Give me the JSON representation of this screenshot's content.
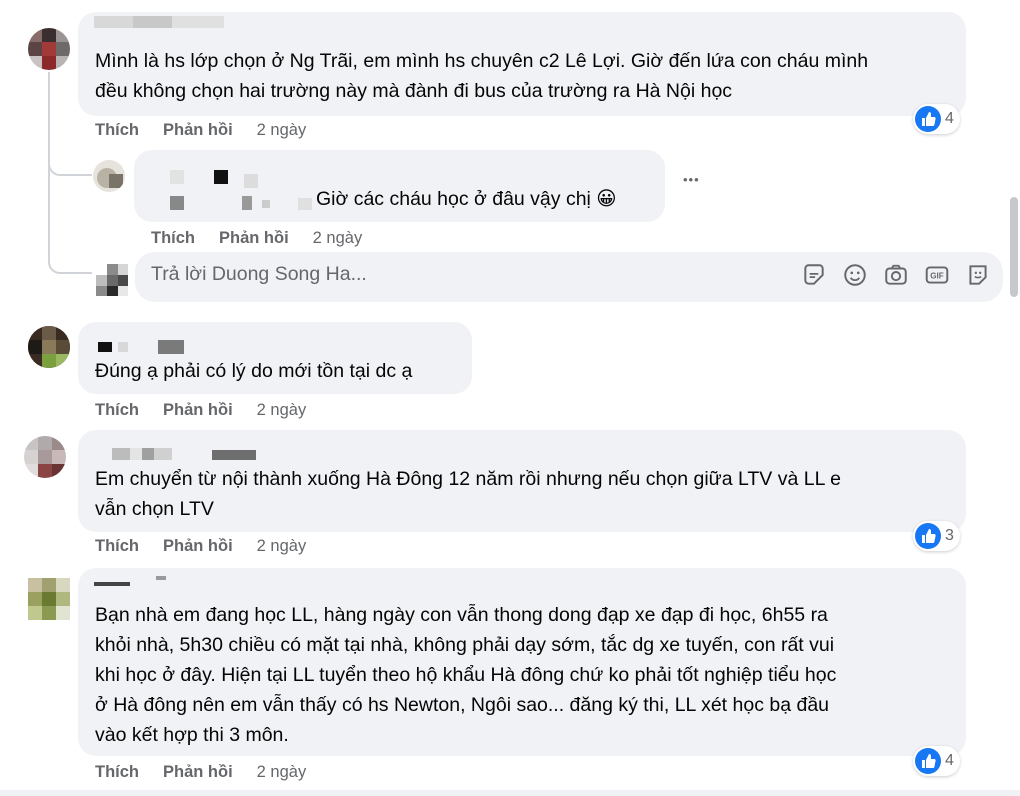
{
  "comments": [
    {
      "text": "Mình là hs lớp chọn ở Ng Trãi, em mình hs chuyên c2 Lê Lợi. Giờ đến lứa con cháu mình\nđều không chọn hai trường này mà đành đi bus của trường ra Hà Nội học",
      "like_label": "Thích",
      "reply_label": "Phản hồi",
      "time": "2 ngày",
      "reactions": "4"
    },
    {
      "text": "Giờ các cháu học ở đâu vậy chị 😀",
      "like_label": "Thích",
      "reply_label": "Phản hồi",
      "time": "2 ngày"
    },
    {
      "text": "Đúng ạ phải có lý do mới tồn tại dc ạ",
      "like_label": "Thích",
      "reply_label": "Phản hồi",
      "time": "2 ngày"
    },
    {
      "text": "Em chuyển từ nội thành xuống Hà Đông 12 năm rồi nhưng nếu chọn giữa LTV và LL e\nvẫn chọn LTV",
      "like_label": "Thích",
      "reply_label": "Phản hồi",
      "time": "2 ngày",
      "reactions": "3"
    },
    {
      "text": "Bạn nhà em đang học LL, hàng ngày con vẫn thong dong đạp xe đạp đi học, 6h55 ra\nkhỏi nhà, 5h30 chiều có mặt tại nhà, không phải dạy sớm, tắc dg xe tuyến, con rất vui\nkhi học ở đây. Hiện tại LL tuyển theo hộ khẩu Hà đông chứ ko phải tốt nghiệp tiểu học\nở Hà đông nên em vẫn thấy có hs Newton, Ngôi sao... đăng ký thi, LL xét học bạ đầu\nvào kết hợp thi 3 môn.",
      "like_label": "Thích",
      "reply_label": "Phản hồi",
      "time": "2 ngày",
      "reactions": "4"
    }
  ],
  "reply_box": {
    "placeholder": "Trả lời Duong Song Ha..."
  },
  "reply_tools": [
    "sticker-icon",
    "emoji-icon",
    "camera-icon",
    "gif-icon",
    "avatar-sticker-icon"
  ],
  "more_label": "•••",
  "colors": {
    "bubble": "#f0f2f5",
    "secondary_text": "#65676b",
    "like_blue": "#1877f2"
  }
}
